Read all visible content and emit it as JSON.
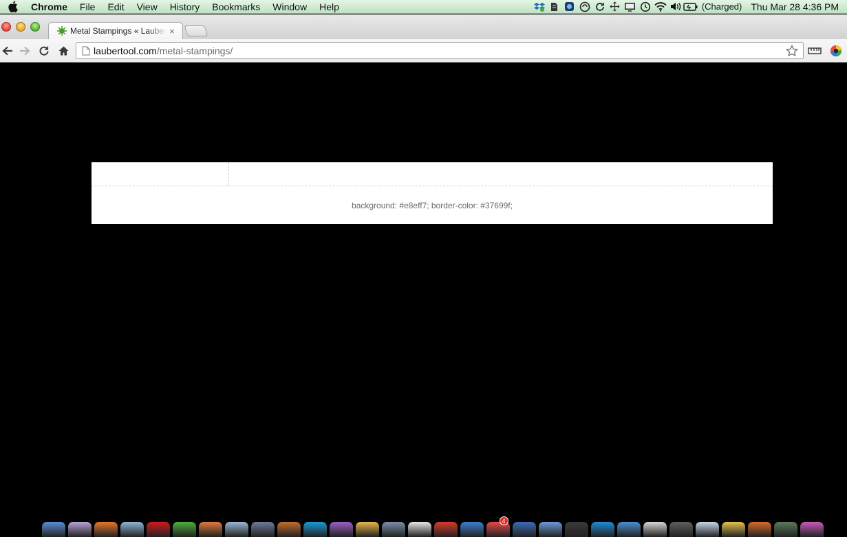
{
  "menubar": {
    "app_name": "Chrome",
    "items": [
      "File",
      "Edit",
      "View",
      "History",
      "Bookmarks",
      "Window",
      "Help"
    ],
    "battery_status": "(Charged)",
    "clock": "Thu Mar 28  4:36 PM"
  },
  "tabs": [
    {
      "title": "Metal Stampings « Lauber Tool",
      "close_label": "×"
    }
  ],
  "omnibox": {
    "host": "laubertool.com",
    "path": "/metal-stampings/"
  },
  "page": {
    "notice_text": "background: #e8eff7; border-color: #37699f;"
  },
  "dock": {
    "badge_count": "4",
    "item_colors": [
      "#5a8fd6",
      "#b9a4d8",
      "#e8772a",
      "#8cb6d8",
      "#d11a1a",
      "#4caf3c",
      "#e07b3a",
      "#9ab8d6",
      "#6b7c9c",
      "#c46d2b",
      "#1a9ad8",
      "#9b5fc8",
      "#e9b84a",
      "#7c8fa8",
      "#e7e7e7",
      "#d83a2a",
      "#3d7fd0",
      "#e64a4a",
      "#3b6cb4",
      "#6c9bd8",
      "#3a3a3a",
      "#1d8cd8",
      "#4a8fd0",
      "#d8d8d8",
      "#5e5e5e",
      "#c7d8ea",
      "#e6c34a",
      "#d86a2a",
      "#5a7a5a",
      "#c85ab8"
    ]
  }
}
